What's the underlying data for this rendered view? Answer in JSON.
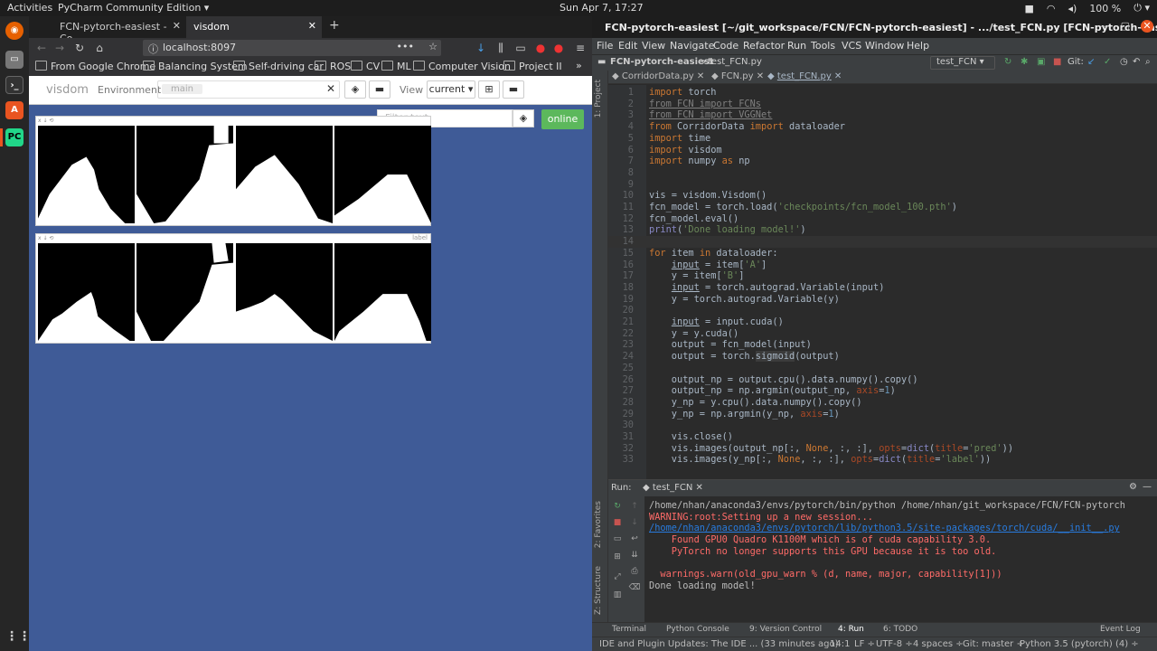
{
  "system": {
    "activities": "Activities",
    "app_name": "PyCharm Community Edition ▾",
    "clock": "Sun Apr 7, 17:27",
    "battery": "100 %"
  },
  "firefox": {
    "tabs": [
      {
        "label": "FCN-pytorch-easiest - Co"
      },
      {
        "label": "visdom"
      }
    ],
    "url": "localhost:8097",
    "bookmarks": [
      "From Google Chrome",
      "Balancing System",
      "Self-driving car",
      "ROS",
      "CV",
      "ML",
      "Computer Vision",
      "Project II"
    ]
  },
  "visdom": {
    "logo": "visdom",
    "environment_label": "Environment",
    "env_chip": "main",
    "view_label": "View",
    "view_select": "current ▾",
    "filter_placeholder": "Filter text",
    "online": "online",
    "panes": [
      {
        "title": ""
      },
      {
        "title": "label"
      }
    ]
  },
  "pycharm": {
    "title": "FCN-pytorch-easiest [~/git_workspace/FCN/FCN-pytorch-easiest] - .../test_FCN.py [FCN-pytorch-easiest] - PyCharm",
    "menu": [
      "File",
      "Edit",
      "View",
      "Navigate",
      "Code",
      "Refactor",
      "Run",
      "Tools",
      "VCS",
      "Window",
      "Help"
    ],
    "nav_project": "FCN-pytorch-easiest",
    "nav_file": "test_FCN.py",
    "run_config": "test_FCN ▾",
    "git_label": "Git:",
    "file_tabs": [
      "CorridorData.py",
      "FCN.py",
      "test_FCN.py"
    ],
    "side_labels": [
      "1: Project",
      "2: Favorites",
      "Z: Structure"
    ],
    "run_title": "Run:",
    "run_tab": "test_FCN",
    "bottom_tabs": [
      "Terminal",
      "Python Console",
      "9: Version Control",
      "4: Run",
      "6: TODO",
      "Event Log"
    ],
    "status": {
      "message": "IDE and Plugin Updates: The IDE ... (33 minutes ago)",
      "position": "14:1",
      "line_sep": "LF ÷",
      "encoding": "UTF-8 ÷",
      "indent": "4 spaces ÷",
      "git": "Git: master ÷",
      "interpreter": "Python 3.5 (pytorch) (4) ÷"
    },
    "output": [
      {
        "kind": "norm",
        "text": "/home/nhan/anaconda3/envs/pytorch/bin/python /home/nhan/git_workspace/FCN/FCN-pytorch"
      },
      {
        "kind": "err",
        "text": "WARNING:root:Setting up a new session..."
      },
      {
        "kind": "link",
        "text": "/home/nhan/anaconda3/envs/pytorch/lib/python3.5/site-packages/torch/cuda/__init__.py"
      },
      {
        "kind": "err",
        "text": "    Found GPU0 Quadro K1100M which is of cuda capability 3.0."
      },
      {
        "kind": "err",
        "text": "    PyTorch no longer supports this GPU because it is too old."
      },
      {
        "kind": "err",
        "text": ""
      },
      {
        "kind": "err",
        "text": "  warnings.warn(old_gpu_warn % (d, name, major, capability[1]))"
      },
      {
        "kind": "norm",
        "text": "Done loading model!"
      }
    ]
  }
}
